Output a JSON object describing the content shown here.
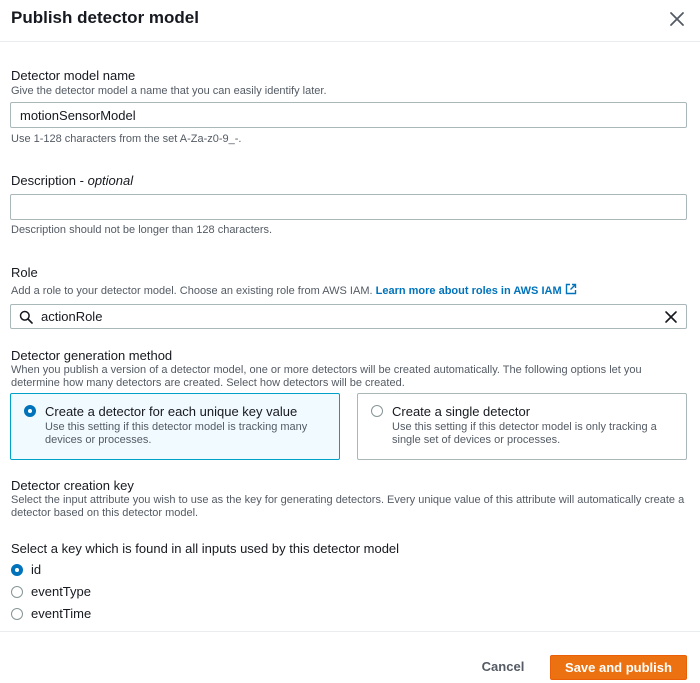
{
  "modal": {
    "title": "Publish detector model"
  },
  "name_field": {
    "label": "Detector model name",
    "description": "Give the detector model a name that you can easily identify later.",
    "value": "motionSensorModel",
    "hint": "Use 1-128 characters from the set A-Za-z0-9_-."
  },
  "description_field": {
    "label": "Description -",
    "optional": "optional",
    "value": "",
    "hint": "Description should not be longer than 128 characters."
  },
  "role_field": {
    "label": "Role",
    "description": "Add a role to your detector model. Choose an existing role from AWS IAM.",
    "link_text": "Learn more about roles in AWS IAM",
    "value": "actionRole"
  },
  "generation": {
    "label": "Detector generation method",
    "description": "When you publish a version of a detector model, one or more detectors will be created automatically. The following options let you determine how many detectors are created. Select how detectors will be created.",
    "options": [
      {
        "title": "Create a detector for each unique key value",
        "desc": "Use this setting if this detector model is tracking many devices or processes.",
        "selected": true
      },
      {
        "title": "Create a single detector",
        "desc": "Use this setting if this detector model is only tracking a single set of devices or processes.",
        "selected": false
      }
    ]
  },
  "creation_key": {
    "label": "Detector creation key",
    "description": "Select the input attribute you wish to use as the key for generating detectors. Every unique value of this attribute will automatically create a detector based on this detector model.",
    "select_label": "Select a key which is found in all inputs used by this detector model",
    "options": [
      {
        "label": "id",
        "selected": true
      },
      {
        "label": "eventType",
        "selected": false
      },
      {
        "label": "eventTime",
        "selected": false
      }
    ]
  },
  "footer": {
    "cancel_label": "Cancel",
    "publish_label": "Save and publish"
  },
  "colors": {
    "accent": "#0073bb",
    "primary_button": "#ec7211",
    "selected_tile_bg": "#f1faff",
    "selected_tile_border": "#00a1c9"
  }
}
